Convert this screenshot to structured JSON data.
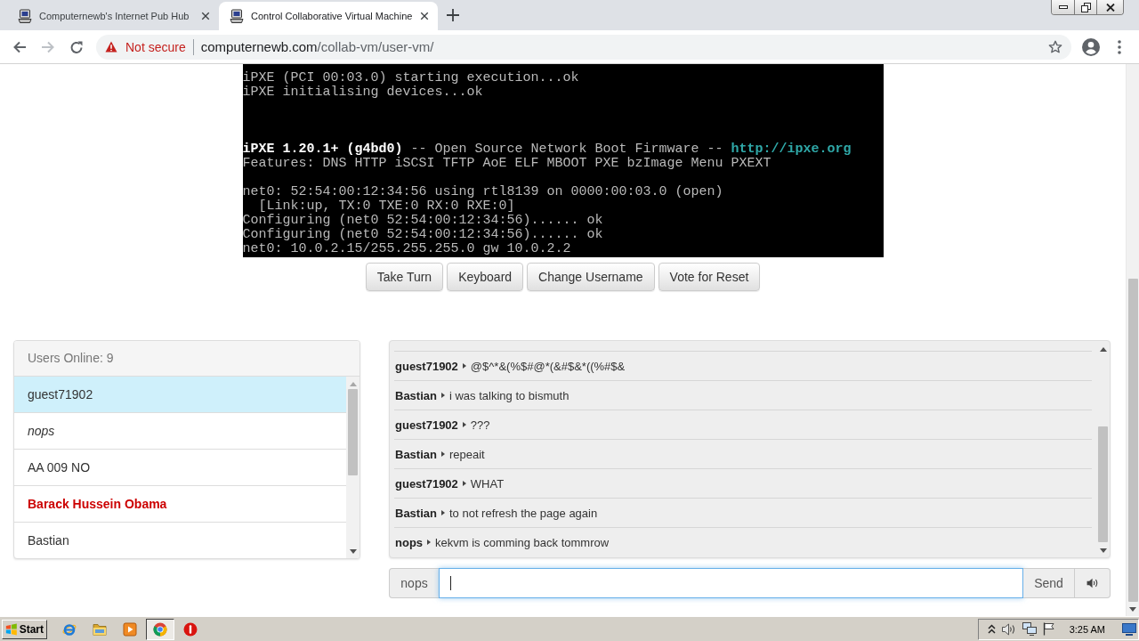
{
  "browser": {
    "tabs": [
      {
        "title": "Computernewb's Internet Pub Hub",
        "selected": false
      },
      {
        "title": "Control Collaborative Virtual Machine",
        "selected": true
      }
    ],
    "nav_buttons": [
      {
        "kind": "back",
        "disabled": false
      },
      {
        "kind": "forward",
        "disabled": true
      },
      {
        "kind": "reload",
        "disabled": false
      }
    ],
    "address": {
      "security": "Not secure",
      "host": "computernewb.com",
      "path": "/collab-vm/user-vm/"
    }
  },
  "vm_screen": {
    "blocks": [
      [
        {
          "text": "iPXE (PCI 00:03.0) starting execution...ok"
        },
        {
          "text": "iPXE initialising devices...ok"
        }
      ],
      [
        {
          "text": "**iPXE 1.20.1+ (g4bd0)** -- Open Source Network Boot Firmware -- ",
          "link": "http://ipxe.org"
        },
        {
          "text": "Features: DNS HTTP iSCSI TFTP AoE ELF MBOOT PXE bzImage Menu PXEXT"
        }
      ],
      [
        {
          "text": "net0: 52:54:00:12:34:56 using rtl8139 on 0000:00:03.0 (open)"
        },
        {
          "text": "  [Link:up, TX:0 TXE:0 RX:0 RXE:0]"
        },
        {
          "text": "Configuring (net0 52:54:00:12:34:56)...... ok"
        },
        {
          "text": "Configuring (net0 52:54:00:12:34:56)...... ok"
        },
        {
          "text": "net0: 10.0.2.15/255.255.255.0 gw 10.0.2.2"
        }
      ]
    ]
  },
  "vm_buttons": [
    "Take Turn",
    "Keyboard",
    "Change Username",
    "Vote for Reset"
  ],
  "users": {
    "header": "Users Online: 9",
    "items": [
      {
        "name": "guest71902",
        "kind": "user",
        "turn": true
      },
      {
        "name": "nops",
        "kind": "self",
        "turn": false
      },
      {
        "name": "AA 009 NO",
        "kind": "user",
        "turn": false
      },
      {
        "name": "Barack Hussein Obama",
        "kind": "admin",
        "turn": false
      },
      {
        "name": "Bastian",
        "kind": "user",
        "turn": false
      }
    ]
  },
  "chat": {
    "messages": [
      {
        "user": "guest71902",
        "text": "@$^*&(%$#@*(&#$&*((%#$&"
      },
      {
        "user": "Bastian",
        "text": "i was talking to bismuth"
      },
      {
        "user": "guest71902",
        "text": "???"
      },
      {
        "user": "Bastian",
        "text": "repeait"
      },
      {
        "user": "guest71902",
        "text": "WHAT"
      },
      {
        "user": "Bastian",
        "text": "to not refresh the page again"
      },
      {
        "user": "nops",
        "text": "kekvm is comming back tommrow"
      }
    ],
    "input": {
      "username": "nops",
      "focused": true
    },
    "send_label": "Send"
  },
  "taskbar": {
    "start_label": "Start",
    "apps": [
      {
        "kind": "ring",
        "active": false
      },
      {
        "kind": "folder",
        "active": false
      },
      {
        "kind": "player",
        "active": false
      },
      {
        "kind": "wheel",
        "active": true
      },
      {
        "kind": "alert",
        "active": false
      }
    ],
    "clock": "3:25 AM"
  }
}
